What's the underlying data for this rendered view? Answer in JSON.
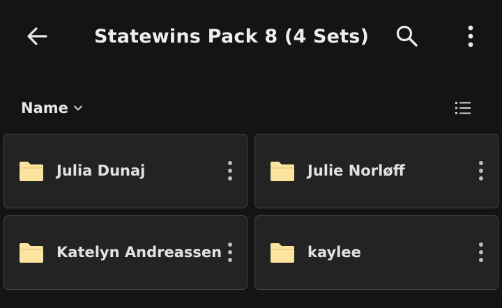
{
  "app_bar": {
    "title": "Statewins Pack 8 (4 Sets)",
    "back_icon": "arrow-back-icon",
    "search_icon": "search-icon",
    "more_icon": "more-vert-icon"
  },
  "sort_bar": {
    "sort_label": "Name",
    "sort_icon": "chevron-down-icon",
    "view_icon": "list-view-icon"
  },
  "folders": [
    {
      "name": "Julia Dunaj"
    },
    {
      "name": "Julie Norløff"
    },
    {
      "name": "Katelyn Andreassen"
    },
    {
      "name": "kaylee"
    }
  ],
  "colors": {
    "background": "#141414",
    "card": "#232323",
    "card_border": "#444444",
    "folder": "#fbe3a0",
    "text": "#e8e8e8"
  }
}
